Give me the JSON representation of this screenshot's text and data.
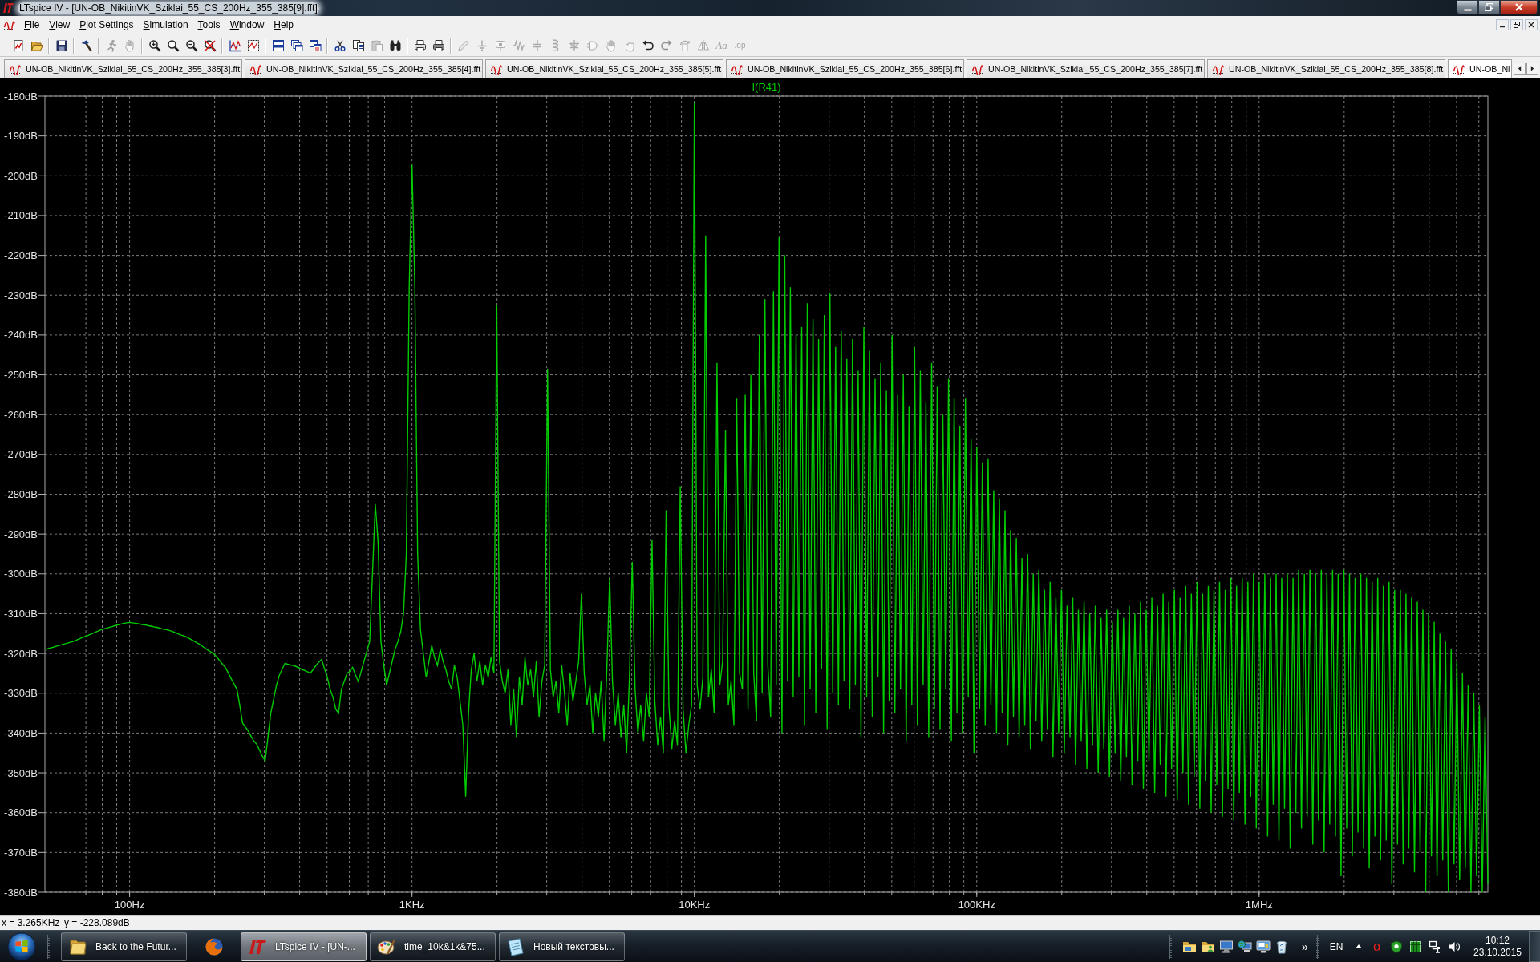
{
  "title_bar": {
    "title": "LTspice IV - [UN-OB_NikitinVK_Sziklai_55_CS_200Hz_355_385[9].fft]"
  },
  "menu": [
    "File",
    "View",
    "Plot Settings",
    "Simulation",
    "Tools",
    "Window",
    "Help"
  ],
  "toolbar": [
    [
      {
        "kind": "new",
        "disabled": false
      },
      {
        "kind": "open",
        "disabled": false
      }
    ],
    [
      {
        "kind": "save",
        "disabled": false
      }
    ],
    [
      {
        "kind": "control",
        "disabled": false
      }
    ],
    [
      {
        "kind": "run",
        "disabled": true
      },
      {
        "kind": "halt",
        "disabled": true
      }
    ],
    [
      {
        "kind": "zoomin",
        "disabled": false
      },
      {
        "kind": "zoompan",
        "disabled": false
      },
      {
        "kind": "zoomout",
        "disabled": false
      },
      {
        "kind": "zoomfit",
        "disabled": false
      }
    ],
    [
      {
        "kind": "autorange",
        "disabled": false
      },
      {
        "kind": "addplot",
        "disabled": false
      }
    ],
    [
      {
        "kind": "tile",
        "disabled": false
      },
      {
        "kind": "cascade",
        "disabled": false
      },
      {
        "kind": "arrange",
        "disabled": false
      }
    ],
    [
      {
        "kind": "cut",
        "disabled": false
      },
      {
        "kind": "copy",
        "disabled": false
      },
      {
        "kind": "paste",
        "disabled": true
      },
      {
        "kind": "find",
        "disabled": false
      }
    ],
    [
      {
        "kind": "printsetup",
        "disabled": false
      },
      {
        "kind": "print",
        "disabled": false
      }
    ],
    [
      {
        "kind": "wire",
        "disabled": true
      },
      {
        "kind": "ground",
        "disabled": true
      },
      {
        "kind": "label",
        "disabled": true
      },
      {
        "kind": "resistor",
        "disabled": true
      },
      {
        "kind": "capacitor",
        "disabled": true
      },
      {
        "kind": "inductor",
        "disabled": true
      },
      {
        "kind": "diode",
        "disabled": true
      },
      {
        "kind": "component",
        "disabled": true
      },
      {
        "kind": "move",
        "disabled": true
      },
      {
        "kind": "drag",
        "disabled": true
      },
      {
        "kind": "undo",
        "disabled": false
      },
      {
        "kind": "redo",
        "disabled": true
      },
      {
        "kind": "rotate",
        "disabled": true
      },
      {
        "kind": "mirror",
        "disabled": true
      },
      {
        "kind": "text",
        "label": "Aa",
        "disabled": true
      },
      {
        "kind": "directive",
        "label": ".op",
        "disabled": true
      }
    ]
  ],
  "tabs": [
    {
      "label": "UN-OB_NikitinVK_Sziklai_55_CS_200Hz_355_385[3].fft",
      "selected": false
    },
    {
      "label": "UN-OB_NikitinVK_Sziklai_55_CS_200Hz_355_385[4].fft",
      "selected": false
    },
    {
      "label": "UN-OB_NikitinVK_Sziklai_55_CS_200Hz_355_385[5].fft",
      "selected": false
    },
    {
      "label": "UN-OB_NikitinVK_Sziklai_55_CS_200Hz_355_385[6].fft",
      "selected": false
    },
    {
      "label": "UN-OB_NikitinVK_Sziklai_55_CS_200Hz_355_385[7].fft",
      "selected": false
    },
    {
      "label": "UN-OB_NikitinVK_Sziklai_55_CS_200Hz_355_385[8].fft",
      "selected": false
    },
    {
      "label": "UN-OB_Ni",
      "selected": true
    }
  ],
  "plot": {
    "chart_data": {
      "type": "line",
      "grid": true,
      "ylim": [
        -380,
        -180
      ],
      "yticks": [
        {
          "value": -180,
          "label": "-180dB"
        },
        {
          "value": -190,
          "label": "-190dB"
        },
        {
          "value": -200,
          "label": "-200dB"
        },
        {
          "value": -210,
          "label": "-210dB"
        },
        {
          "value": -220,
          "label": "-220dB"
        },
        {
          "value": -230,
          "label": "-230dB"
        },
        {
          "value": -240,
          "label": "-240dB"
        },
        {
          "value": -250,
          "label": "-250dB"
        },
        {
          "value": -260,
          "label": "-260dB"
        },
        {
          "value": -270,
          "label": "-270dB"
        },
        {
          "value": -280,
          "label": "-280dB"
        },
        {
          "value": -290,
          "label": "-290dB"
        },
        {
          "value": -300,
          "label": "-300dB"
        },
        {
          "value": -310,
          "label": "-310dB"
        },
        {
          "value": -320,
          "label": "-320dB"
        },
        {
          "value": -330,
          "label": "-330dB"
        },
        {
          "value": -340,
          "label": "-340dB"
        },
        {
          "value": -350,
          "label": "-350dB"
        },
        {
          "value": -360,
          "label": "-360dB"
        },
        {
          "value": -370,
          "label": "-370dB"
        },
        {
          "value": -380,
          "label": "-380dB"
        }
      ],
      "categories": [
        null,
        null,
        null,
        null,
        null,
        null,
        null,
        null,
        null,
        null,
        null,
        null,
        null,
        null,
        null,
        null,
        null,
        null,
        null,
        null,
        null,
        null,
        null,
        null,
        null,
        null,
        null,
        null,
        null,
        null,
        "100Hz",
        null,
        null,
        null,
        null,
        null,
        null,
        null,
        null,
        null,
        null,
        null,
        null,
        null,
        null,
        null,
        null,
        null,
        null,
        null,
        null,
        null,
        null,
        null,
        null,
        null,
        null,
        null,
        null,
        null,
        null,
        null,
        null,
        null,
        null,
        null,
        null,
        null,
        null,
        null,
        null,
        null,
        null,
        null,
        null,
        null,
        null,
        null,
        null,
        null,
        null,
        null,
        null,
        null,
        null,
        null,
        null,
        null,
        null,
        null,
        null,
        null,
        null,
        null,
        null,
        null,
        null,
        null,
        null,
        null,
        null,
        null,
        null,
        null,
        null,
        null,
        null,
        null,
        null,
        null,
        null,
        null,
        null,
        null,
        null,
        null,
        null,
        null,
        null,
        null,
        null,
        null,
        null,
        null,
        null,
        null,
        null,
        null,
        null,
        null,
        "1KHz",
        null,
        null,
        null,
        null,
        null,
        null,
        null,
        null,
        null,
        null,
        null,
        null,
        null,
        null,
        null,
        null,
        null,
        null,
        null,
        null,
        null,
        null,
        null,
        null,
        null,
        null,
        null,
        null,
        null,
        null,
        null,
        null,
        null,
        null,
        null,
        null,
        null,
        null,
        null,
        null,
        null,
        null,
        null,
        null,
        null,
        null,
        null,
        null,
        null,
        null,
        null,
        null,
        null,
        null,
        null,
        null,
        null,
        null,
        null,
        null,
        null,
        null,
        null,
        null,
        null,
        null,
        null,
        null,
        null,
        null,
        null,
        null,
        null,
        null,
        null,
        null,
        null,
        null,
        null,
        null,
        null,
        null,
        null,
        null,
        null,
        null,
        null,
        null,
        null,
        null,
        null,
        null,
        null,
        null,
        null,
        null,
        null,
        null,
        null,
        "10KHz",
        null,
        null,
        null,
        null,
        null,
        null,
        null,
        null,
        null,
        null,
        null,
        null,
        null,
        null,
        null,
        null,
        null,
        null,
        null,
        null,
        null,
        null,
        null,
        null,
        null,
        null,
        null,
        null,
        null,
        null,
        null,
        null,
        null,
        null,
        null,
        null,
        null,
        null,
        null,
        null,
        null,
        null,
        null,
        null,
        null,
        null,
        null,
        null,
        null,
        null,
        null,
        null,
        null,
        null,
        null,
        null,
        null,
        null,
        null,
        null,
        null,
        null,
        null,
        null,
        null,
        null,
        null,
        null,
        null,
        null,
        null,
        null,
        null,
        null,
        null,
        null,
        null,
        null,
        null,
        null,
        null,
        null,
        null,
        null,
        null,
        null,
        null,
        null,
        null,
        null,
        null,
        null,
        null,
        null,
        null,
        null,
        null,
        null,
        null,
        "100KHz",
        null,
        null,
        null,
        null,
        null,
        null,
        null,
        null,
        null,
        null,
        null,
        null,
        null,
        null,
        null,
        null,
        null,
        null,
        null,
        null,
        null,
        null,
        null,
        null,
        null,
        null,
        null,
        null,
        null,
        null,
        null,
        null,
        null,
        null,
        null,
        null,
        null,
        null,
        null,
        null,
        null,
        null,
        null,
        null,
        null,
        null,
        null,
        null,
        null,
        null,
        null,
        null,
        null,
        null,
        null,
        null,
        null,
        null,
        null,
        null,
        null,
        null,
        null,
        null,
        null,
        null,
        null,
        null,
        null,
        null,
        null,
        null,
        null,
        null,
        null,
        null,
        null,
        null,
        null,
        null,
        null,
        null,
        null,
        null,
        null,
        null,
        null,
        null,
        null,
        null,
        null,
        null,
        null,
        null,
        null,
        null,
        null,
        null,
        null,
        "1MHz",
        null,
        null,
        null,
        null,
        null,
        null,
        null,
        null,
        null,
        null,
        null,
        null,
        null,
        null,
        null,
        null,
        null,
        null,
        null,
        null,
        null,
        null,
        null,
        null,
        null,
        null,
        null,
        null,
        null,
        null,
        null,
        null,
        null,
        null,
        null,
        null,
        null,
        null,
        null,
        null,
        null,
        null,
        null,
        null,
        null,
        null,
        null,
        null,
        null,
        null,
        null,
        null,
        null,
        null,
        null,
        null,
        null,
        null,
        null,
        null,
        null,
        null,
        null,
        null,
        null,
        null,
        null,
        null,
        null,
        null,
        null,
        null,
        null,
        null,
        null,
        null,
        null,
        null,
        null,
        null,
        null
      ],
      "series": [
        {
          "name": "I(R41)",
          "color": "#00cc00",
          "values": [
            -319.0,
            -318.8,
            -318.6,
            -318.4,
            -318.2,
            -318.0,
            -317.8,
            -317.6,
            -317.4,
            -317.2,
            -317.0,
            -316.7,
            -316.4,
            -316.1,
            -315.8,
            -315.5,
            -315.2,
            -314.9,
            -314.6,
            -314.3,
            -314.0,
            -313.8,
            -313.6,
            -313.4,
            -313.2,
            -313.0,
            -312.8,
            -312.6,
            -312.4,
            -312.3,
            -312.2,
            -312.3,
            -312.4,
            -312.5,
            -312.7,
            -312.8,
            -312.9,
            -313.1,
            -313.2,
            -313.4,
            -313.5,
            -313.7,
            -313.9,
            -314.0,
            -314.2,
            -314.4,
            -314.7,
            -315.0,
            -315.3,
            -315.5,
            -315.8,
            -316.2,
            -316.6,
            -317.0,
            -317.4,
            -317.8,
            -318.3,
            -318.8,
            -319.3,
            -319.7,
            -320.2,
            -321.0,
            -321.9,
            -322.8,
            -323.6,
            -325.0,
            -326.4,
            -327.7,
            -329.0,
            -333.0,
            -337.5,
            -338.5,
            -339.5,
            -340.8,
            -342.0,
            -342.8,
            -344.3,
            -345.8,
            -347.0,
            -341.0,
            -335.0,
            -331.5,
            -328.0,
            -325.5,
            -324.0,
            -322.5,
            -322.7,
            -322.9,
            -323.0,
            -323.3,
            -323.6,
            -324.0,
            -324.3,
            -324.6,
            -325.0,
            -324.0,
            -323.0,
            -322.2,
            -321.5,
            -323.8,
            -326.0,
            -329.0,
            -331.0,
            -334.0,
            -335.0,
            -329.0,
            -327.0,
            -325.0,
            -324.5,
            -323.5,
            -325.5,
            -327.0,
            -324.5,
            -322.0,
            -319.5,
            -317.0,
            -300.0,
            -282.5,
            -292.0,
            -317.0,
            -323.0,
            -328.0,
            -325.0,
            -322.0,
            -319.0,
            -317.0,
            -314.5,
            -310.0,
            -295.0,
            -228.0,
            -197.2,
            -228.0,
            -295.0,
            -314.0,
            -320.0,
            -326.0,
            -322.0,
            -318.0,
            -321.0,
            -323.0,
            -319.0,
            -322.0,
            -324.0,
            -327.0,
            -329.0,
            -323.0,
            -326.0,
            -332.0,
            -338.0,
            -356.0,
            -335.0,
            -324.0,
            -320.0,
            -327.0,
            -322.0,
            -328.0,
            -323.0,
            -326.0,
            -321.0,
            -325.0,
            -232.5,
            -322.0,
            -327.0,
            -330.0,
            -324.0,
            -338.0,
            -329.0,
            -341.0,
            -326.0,
            -333.0,
            -321.0,
            -328.0,
            -324.0,
            -331.0,
            -322.0,
            -336.0,
            -327.0,
            -323.0,
            -248.5,
            -324.0,
            -331.0,
            -327.0,
            -335.0,
            -323.0,
            -330.0,
            -338.0,
            -325.0,
            -332.0,
            -327.0,
            -322.0,
            -305.0,
            -325.0,
            -333.0,
            -328.0,
            -340.0,
            -330.0,
            -336.0,
            -327.0,
            -342.0,
            -324.0,
            -301.0,
            -327.0,
            -338.0,
            -330.0,
            -341.0,
            -333.0,
            -345.0,
            -326.0,
            -297.0,
            -329.0,
            -340.0,
            -333.0,
            -342.0,
            -330.0,
            -336.0,
            -291.5,
            -332.0,
            -343.0,
            -336.0,
            -345.0,
            -284.0,
            -333.0,
            -344.0,
            -337.0,
            -343.0,
            -278.0,
            -334.0,
            -345.0,
            -338.0,
            -333.0,
            -181.5,
            -328.0,
            -334.0,
            -326.0,
            -215.0,
            -331.0,
            -324.0,
            -335.0,
            -247.0,
            -328.0,
            -322.0,
            -264.0,
            -333.0,
            -327.0,
            -338.0,
            -256.0,
            -325.0,
            -329.0,
            -255.0,
            -334.0,
            -250.0,
            -325.0,
            -337.0,
            -240.0,
            -330.0,
            -231.0,
            -323.0,
            -336.0,
            -229.0,
            -328.0,
            -215.5,
            -340.0,
            -220.0,
            -327.0,
            -228.0,
            -331.0,
            -240.0,
            -326.0,
            -238.0,
            -338.0,
            -232.0,
            -329.0,
            -236.0,
            -335.0,
            -241.0,
            -324.0,
            -235.0,
            -339.0,
            -229.5,
            -330.0,
            -243.0,
            -333.0,
            -239.0,
            -327.0,
            -246.0,
            -334.0,
            -241.0,
            -328.0,
            -249.0,
            -341.0,
            -238.0,
            -331.0,
            -244.0,
            -336.0,
            -251.0,
            -326.0,
            -247.0,
            -340.0,
            -254.0,
            -332.0,
            -240.0,
            -335.0,
            -255.0,
            -329.0,
            -250.0,
            -342.0,
            -258.0,
            -333.0,
            -243.0,
            -338.0,
            -249.0,
            -328.0,
            -257.0,
            -341.0,
            -247.0,
            -334.0,
            -253.0,
            -339.0,
            -260.0,
            -329.0,
            -251.0,
            -342.0,
            -256.0,
            -335.0,
            -263.0,
            -340.0,
            -256.0,
            -331.0,
            -266.0,
            -345.0,
            -268.0,
            -334.0,
            -272.0,
            -338.0,
            -271.0,
            -333.0,
            -279.0,
            -340.0,
            -281.0,
            -335.0,
            -284.0,
            -343.0,
            -289.0,
            -336.0,
            -291.0,
            -341.0,
            -296.0,
            -338.0,
            -295.0,
            -344.0,
            -300.0,
            -337.0,
            -299.0,
            -342.0,
            -304.0,
            -339.0,
            -302.0,
            -346.0,
            -306.0,
            -340.0,
            -304.0,
            -345.0,
            -308.0,
            -341.0,
            -306.0,
            -348.0,
            -309.0,
            -342.0,
            -307.0,
            -349.0,
            -310.0,
            -343.0,
            -308.0,
            -350.0,
            -311.0,
            -344.0,
            -309.0,
            -351.0,
            -312.0,
            -345.0,
            -309.0,
            -352.0,
            -311.0,
            -346.0,
            -308.0,
            -353.0,
            -310.0,
            -347.0,
            -307.0,
            -354.0,
            -309.0,
            -347.0,
            -306.0,
            -355.0,
            -308.0,
            -348.0,
            -305.0,
            -356.0,
            -307.0,
            -349.0,
            -304.0,
            -357.0,
            -306.0,
            -350.0,
            -303.0,
            -358.0,
            -305.0,
            -351.0,
            -302.0,
            -359.0,
            -305.0,
            -352.0,
            -303.0,
            -360.0,
            -304.0,
            -353.0,
            -302.0,
            -361.0,
            -304.0,
            -354.0,
            -301.0,
            -362.0,
            -303.0,
            -355.0,
            -301.0,
            -363.0,
            -302.0,
            -356.0,
            -300.0,
            -364.0,
            -302.0,
            -357.0,
            -300.0,
            -366.0,
            -301.0,
            -358.0,
            -300.0,
            -367.0,
            -301.0,
            -359.0,
            -300.0,
            -369.0,
            -301.0,
            -360.0,
            -299.0,
            -364.0,
            -300.0,
            -361.0,
            -299.0,
            -368.0,
            -300.0,
            -362.0,
            -299.0,
            -370.0,
            -300.0,
            -363.0,
            -299.0,
            -366.0,
            -300.0,
            -376.0,
            -299.0,
            -364.0,
            -300.0,
            -371.0,
            -301.0,
            -365.0,
            -300.0,
            -369.0,
            -301.0,
            -374.0,
            -302.0,
            -366.0,
            -301.0,
            -372.0,
            -303.0,
            -367.0,
            -302.0,
            -378.0,
            -304.0,
            -368.0,
            -304.0,
            -373.0,
            -305.0,
            -369.0,
            -306.0,
            -375.0,
            -307.0,
            -370.0,
            -309.0,
            -380.0,
            -310.0,
            -371.0,
            -312.0,
            -376.0,
            -315.0,
            -372.0,
            -317.0,
            -380.0,
            -319.0,
            -373.0,
            -322.0,
            -377.0,
            -325.0,
            -374.0,
            -328.0,
            -380.0,
            -330.0,
            -376.0,
            -333.0,
            -380.0,
            -336.0,
            -378.0
          ]
        }
      ]
    }
  },
  "status_bar": {
    "x_readout": "x = 3.265KHz",
    "y_readout": "y = -228.089dB"
  },
  "taskbar": {
    "buttons": [
      {
        "kind": "folder",
        "label": "Back to the Futur...",
        "selected": false
      },
      {
        "kind": "browser",
        "selected": false
      },
      {
        "kind": "ltspice",
        "label": "LTspice IV - [UN-...",
        "selected": true
      },
      {
        "kind": "paint",
        "label": "time_10k&1k&75...",
        "selected": false
      },
      {
        "kind": "notepad",
        "label": "Новый текстовы...",
        "selected": false
      }
    ],
    "deskband": [
      {
        "kind": "folder"
      },
      {
        "kind": "userfolder"
      },
      {
        "kind": "computer"
      },
      {
        "kind": "netcomputer"
      },
      {
        "kind": "screen"
      },
      {
        "kind": "recycle"
      }
    ],
    "overflow": "»",
    "language": "EN",
    "tray": [
      {
        "kind": "alpha",
        "text": "α"
      },
      {
        "kind": "shield"
      },
      {
        "kind": "grid"
      },
      {
        "kind": "network"
      },
      {
        "kind": "volume"
      }
    ],
    "time": "10:12",
    "date": "23.10.2015"
  }
}
